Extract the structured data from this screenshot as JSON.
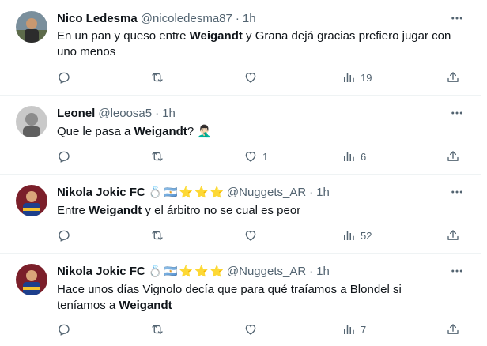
{
  "tweets": [
    {
      "name": "Nico Ledesma",
      "handle": "@nicoledesma87",
      "time": "1h",
      "badges": [],
      "text_segments": [
        {
          "t": "En un pan y queso entre ",
          "b": false
        },
        {
          "t": "Weigandt",
          "b": true
        },
        {
          "t": " y Grana dejá gracias prefiero jugar con uno menos",
          "b": false
        }
      ],
      "views": "19",
      "likes": ""
    },
    {
      "name": "Leonel",
      "handle": "@leoosa5",
      "time": "1h",
      "badges": [],
      "text_segments": [
        {
          "t": "Que le pasa a ",
          "b": false
        },
        {
          "t": "Weigandt",
          "b": true
        },
        {
          "t": "? 🤦🏻‍♂️",
          "b": false
        }
      ],
      "views": "6",
      "likes": "1"
    },
    {
      "name": "Nikola Jokic FC",
      "handle": "@Nuggets_AR",
      "time": "1h",
      "badges": [
        "💍",
        "🇦🇷",
        "⭐",
        "⭐",
        "⭐"
      ],
      "text_segments": [
        {
          "t": "Entre ",
          "b": false
        },
        {
          "t": "Weigandt",
          "b": true
        },
        {
          "t": " y el árbitro no se cual es peor",
          "b": false
        }
      ],
      "views": "52",
      "likes": ""
    },
    {
      "name": "Nikola Jokic FC",
      "handle": "@Nuggets_AR",
      "time": "1h",
      "badges": [
        "💍",
        "🇦🇷",
        "⭐",
        "⭐",
        "⭐"
      ],
      "text_segments": [
        {
          "t": "Hace unos días Vignolo decía que para qué traíamos a Blondel si teníamos a ",
          "b": false
        },
        {
          "t": "Weigandt",
          "b": true
        }
      ],
      "views": "7",
      "likes": ""
    }
  ],
  "icons": {
    "reply": "reply-icon",
    "retweet": "retweet-icon",
    "like": "heart-icon",
    "views": "views-icon",
    "share": "share-icon",
    "more": "more-icon"
  },
  "colors": {
    "text": "#0f1419",
    "secondary": "#536471",
    "divider": "#eff3f4"
  }
}
